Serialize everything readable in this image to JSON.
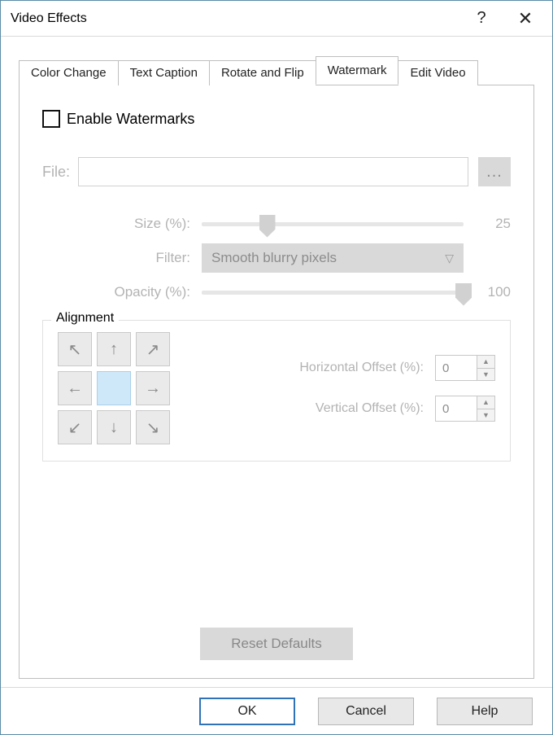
{
  "window": {
    "title": "Video Effects"
  },
  "tabs": {
    "items": [
      "Color Change",
      "Text Caption",
      "Rotate and Flip",
      "Watermark",
      "Edit Video"
    ],
    "active_index": 3
  },
  "watermark": {
    "enable_label": "Enable Watermarks",
    "enable_checked": false,
    "file_label": "File:",
    "file_value": "",
    "browse_label": "...",
    "size_label": "Size (%):",
    "size_value": 25,
    "filter_label": "Filter:",
    "filter_value": "Smooth blurry pixels",
    "opacity_label": "Opacity (%):",
    "opacity_value": 100,
    "alignment": {
      "legend": "Alignment",
      "selected": "center",
      "h_offset_label": "Horizontal Offset (%):",
      "h_offset_value": 0,
      "v_offset_label": "Vertical Offset (%):",
      "v_offset_value": 0
    },
    "reset_label": "Reset Defaults"
  },
  "footer": {
    "ok": "OK",
    "cancel": "Cancel",
    "help": "Help"
  }
}
